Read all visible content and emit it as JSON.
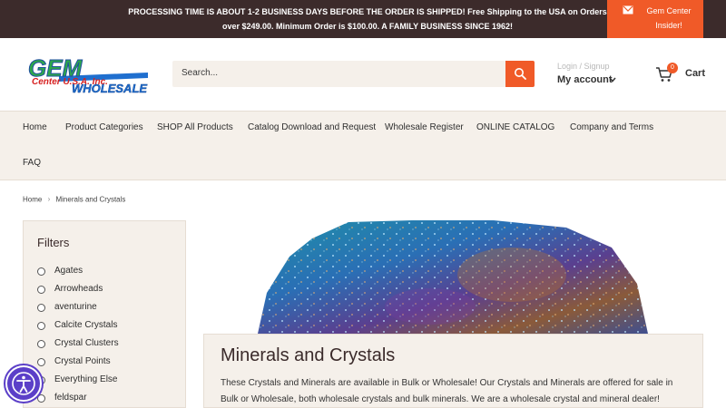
{
  "announcement": {
    "line1": "PROCESSING TIME IS ABOUT 1-2 BUSINESS DAYS BEFORE THE ORDER IS SHIPPED! Free Shipping to the USA on Orders",
    "line2": "over $249.00. Minimum Order is $100.00. A FAMILY BUSINESS SINCE 1962!",
    "insider_line1": "Gem Center",
    "insider_line2": "Insider!",
    "icon": "mail-icon"
  },
  "logo": {
    "top_text": "GEM",
    "mid_text": "Center U.S.A. Inc.",
    "bottom_text": "WHOLESALE",
    "colors": {
      "blue": "#1f6fcf",
      "green": "#2ea84a",
      "red": "#d62020"
    }
  },
  "search": {
    "placeholder": "Search...",
    "icon": "search-icon"
  },
  "account": {
    "login_label": "Login / Signup",
    "account_label": "My account"
  },
  "cart": {
    "count": "0",
    "label": "Cart",
    "icon": "cart-icon"
  },
  "nav": {
    "items": [
      "Home",
      "Product Categories",
      "SHOP All Products",
      "Catalog Download and Request",
      "Wholesale Register",
      "ONLINE CATALOG",
      "Company and Terms",
      "FAQ"
    ]
  },
  "breadcrumb": {
    "home": "Home",
    "current": "Minerals and Crystals"
  },
  "filters": {
    "title": "Filters",
    "options": [
      "Agates",
      "Arrowheads",
      "aventurine",
      "Calcite Crystals",
      "Crystal Clusters",
      "Crystal Points",
      "Everything Else",
      "feldspar"
    ]
  },
  "collection": {
    "title": "Minerals and Crystals",
    "description": "These Crystals and Minerals are available in Bulk or Wholesale! Our Crystals and Minerals are offered for sale in Bulk or Wholesale, both wholesale crystals and bulk minerals.  We are a wholesale crystal and mineral dealer!"
  },
  "colors": {
    "accent": "#f05a28",
    "announcement_bg": "#3c2b2b",
    "panel_bg": "#f5f0ea",
    "accessibility": "#5b3fc8"
  },
  "accessibility": {
    "icon": "accessibility-icon"
  }
}
